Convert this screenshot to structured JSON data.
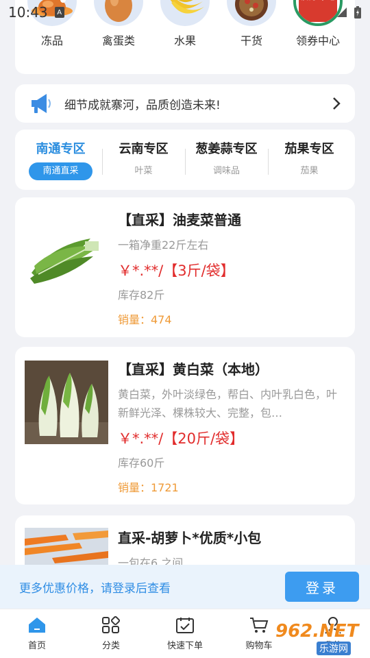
{
  "status_bar": {
    "time": "10:43",
    "indicator": "A"
  },
  "categories": [
    {
      "label": "冻品",
      "icon": "roast-chicken-icon"
    },
    {
      "label": "禽蛋类",
      "icon": "egg-icon"
    },
    {
      "label": "水果",
      "icon": "banana-icon"
    },
    {
      "label": "干货",
      "icon": "dried-goods-icon"
    },
    {
      "label": "领券中心",
      "icon": "coupon-icon",
      "icon_text": "领券中心"
    }
  ],
  "notice": {
    "text": "细节成就寨河，品质创造未来!"
  },
  "zones": [
    {
      "title": "南通专区",
      "sub": "南通直采",
      "active": true
    },
    {
      "title": "云南专区",
      "sub": "叶菜",
      "active": false
    },
    {
      "title": "葱姜蒜专区",
      "sub": "调味品",
      "active": false
    },
    {
      "title": "茄果专区",
      "sub": "茄果",
      "active": false
    }
  ],
  "products": [
    {
      "name": "【直采】油麦菜普通",
      "desc": "一箱净重22斤左右",
      "price": "￥*.**/【3斤/袋】",
      "stock": "库存82斤",
      "sales": "销量：474"
    },
    {
      "name": "【直采】黄白菜（本地）",
      "desc": "黄白菜，外叶淡绿色，帮白、内叶乳白色，叶新鲜光泽、棵株较大、完整，包…",
      "price": "￥*.**/【20斤/袋】",
      "stock": "库存60斤",
      "sales": "销量：1721"
    },
    {
      "name": "直采-胡萝卜*优质*小包",
      "desc": "一包在6.之间"
    }
  ],
  "login_bar": {
    "hint": "更多优惠价格，请登录后查看",
    "button": "登录"
  },
  "nav": [
    {
      "label": "首页",
      "icon": "home-icon",
      "active": true
    },
    {
      "label": "分类",
      "icon": "category-icon"
    },
    {
      "label": "快速下单",
      "icon": "quick-order-icon"
    },
    {
      "label": "购物车",
      "icon": "cart-icon"
    },
    {
      "label": "我的",
      "icon": "profile-icon"
    }
  ],
  "watermark": {
    "text": "962.NET",
    "sub": "乐游网"
  },
  "colors": {
    "accent": "#2f96ea",
    "price": "#e12c2c",
    "sales": "#ef9a37",
    "background": "#f1f2f6"
  }
}
